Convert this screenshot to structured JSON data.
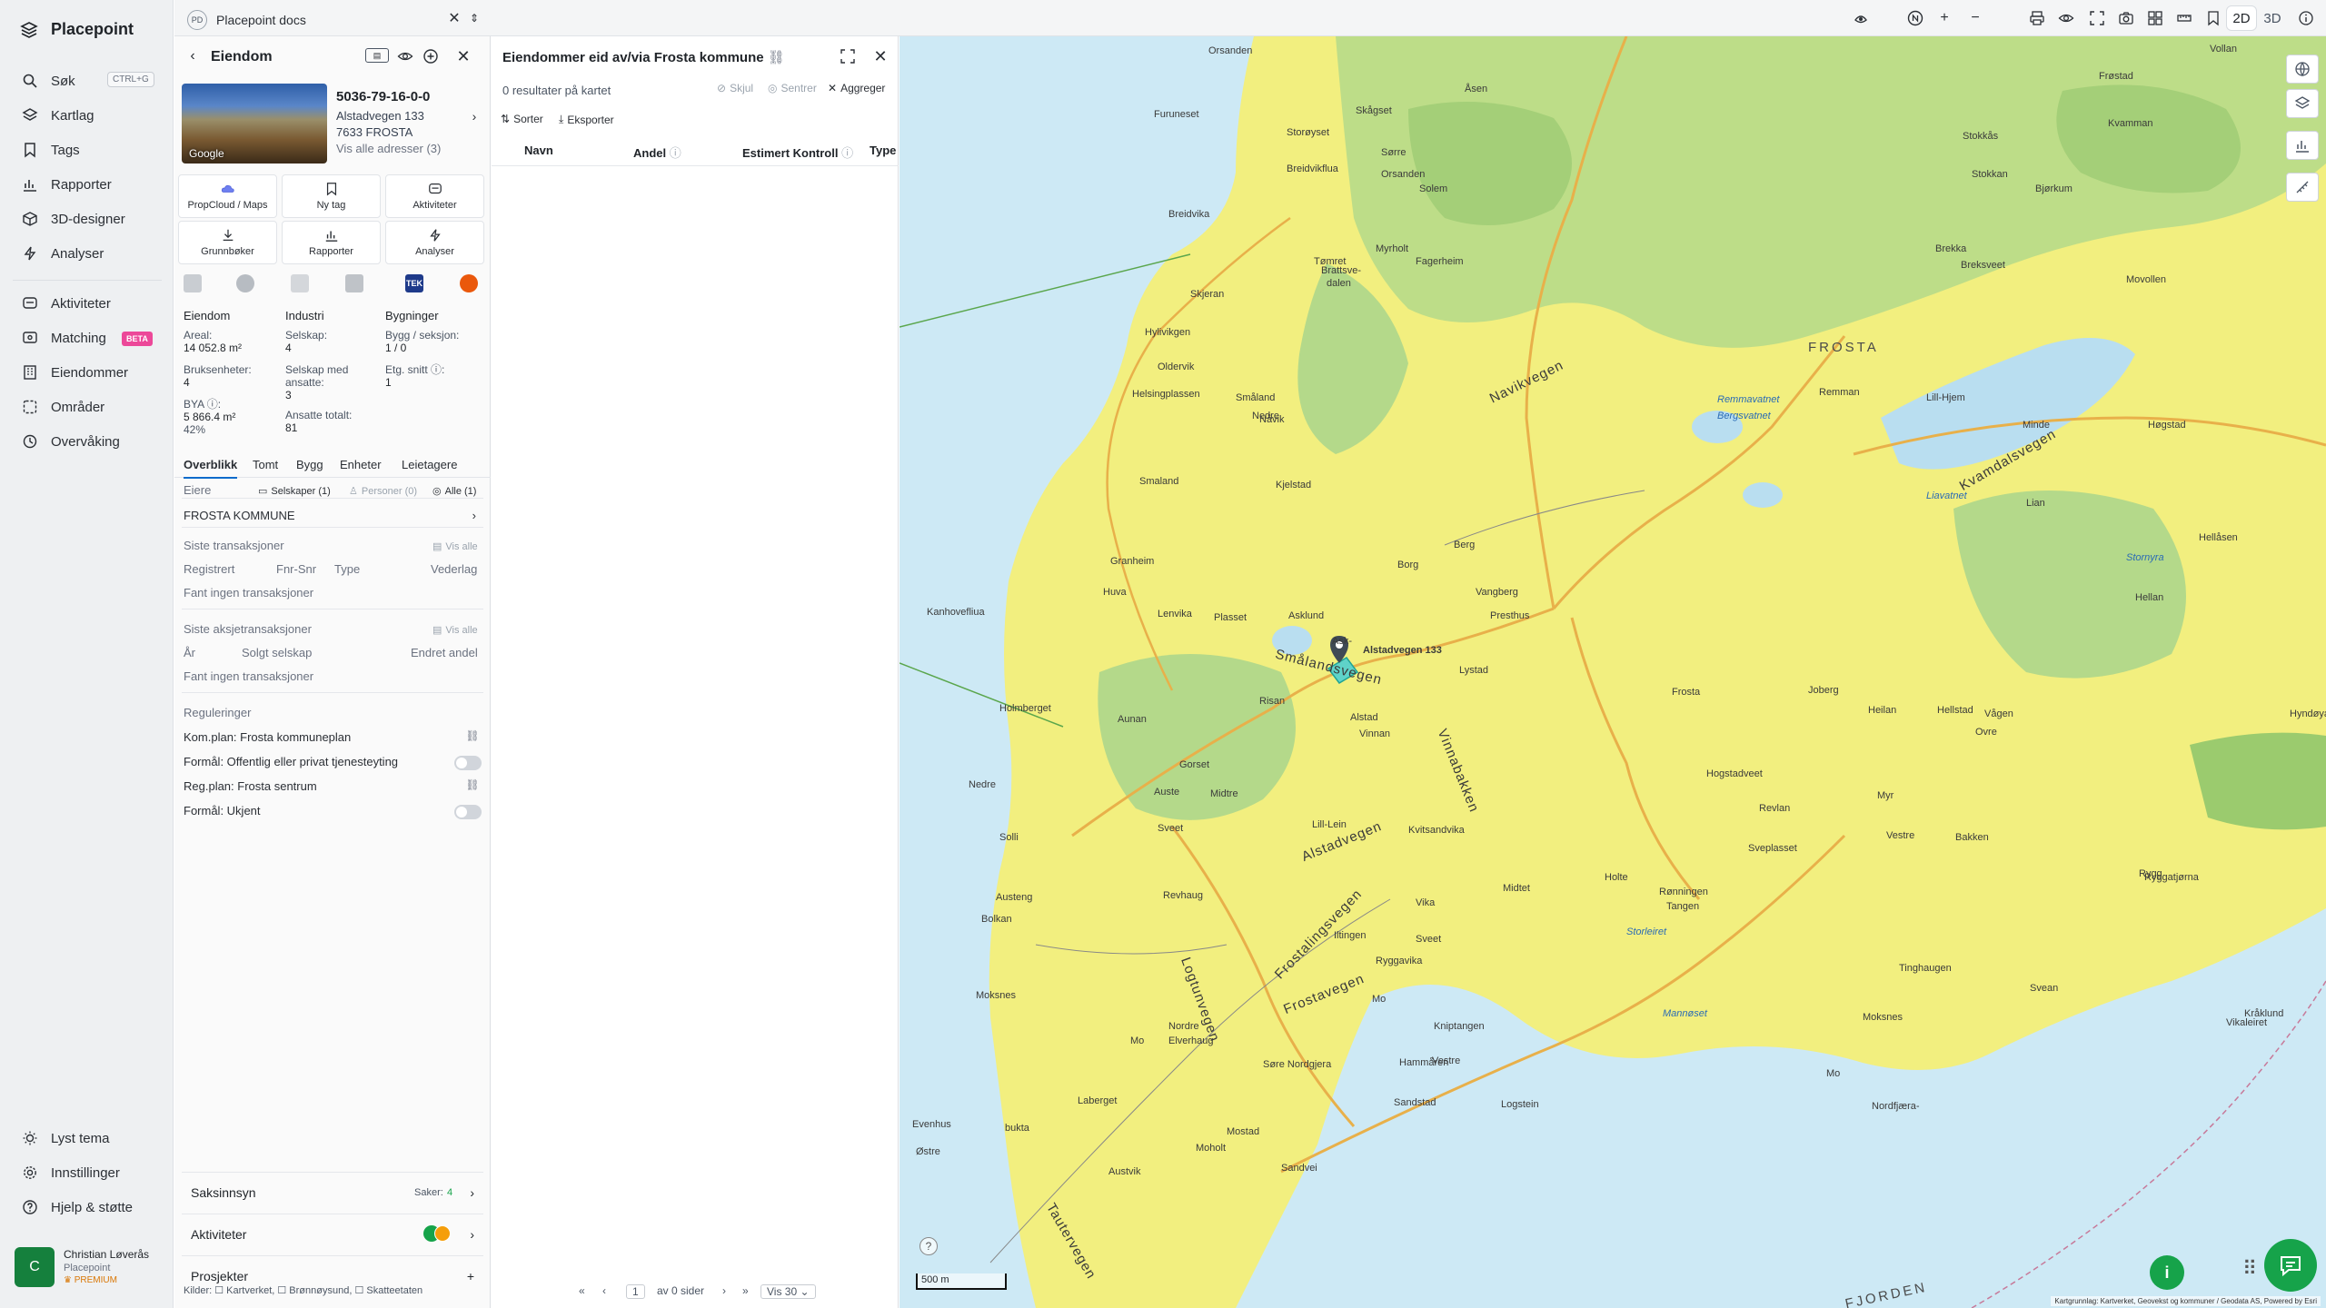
{
  "app": {
    "name": "Placepoint"
  },
  "sidebar": {
    "items": [
      {
        "label": "Søk",
        "shortcut": "CTRL+G",
        "icon": "search-icon"
      },
      {
        "label": "Kartlag",
        "icon": "layers-icon"
      },
      {
        "label": "Tags",
        "icon": "bookmark-icon"
      },
      {
        "label": "Rapporter",
        "icon": "chart-icon"
      },
      {
        "label": "3D-designer",
        "icon": "cube-icon"
      },
      {
        "label": "Analyser",
        "icon": "bolt-icon"
      },
      {
        "label": "Aktiviteter",
        "icon": "activity-icon"
      },
      {
        "label": "Matching",
        "badge": "BETA",
        "icon": "matching-icon"
      },
      {
        "label": "Eiendommer",
        "icon": "building-icon"
      },
      {
        "label": "Områder",
        "icon": "area-icon"
      },
      {
        "label": "Overvåking",
        "icon": "monitor-icon"
      }
    ],
    "bottom": [
      {
        "label": "Lyst tema",
        "icon": "sun-icon"
      },
      {
        "label": "Innstillinger",
        "icon": "gear-icon"
      },
      {
        "label": "Hjelp & støtte",
        "icon": "help-icon"
      }
    ],
    "user": {
      "initial": "C",
      "name": "Christian Løverås",
      "org": "Placepoint",
      "plan": "PREMIUM"
    }
  },
  "tabbar": {
    "badge": "PD",
    "doc_title": "Placepoint docs",
    "view_2d": "2D",
    "view_3d": "3D"
  },
  "property": {
    "header": "Eiendom",
    "photo_credit": "Google",
    "id": "5036-79-16-0-0",
    "address": "Alstadvegen 133",
    "postal": "7633 FROSTA",
    "all_addresses": "Vis alle adresser (3)",
    "actions": [
      "PropCloud / Maps",
      "Ny tag",
      "Aktiviteter",
      "Grunnbøker",
      "Rapporter",
      "Analyser"
    ],
    "tek_badge": "TEK",
    "stats": {
      "col1_header": "Eiendom",
      "col2_header": "Industri",
      "col3_header": "Bygninger",
      "areal_label": "Areal:",
      "areal_value": "14 052.8 m²",
      "bruks_label": "Bruksenheter:",
      "bruks_value": "4",
      "bya_label": "BYA ⓘ:",
      "bya_value": "5 866.4 m²",
      "bya_pct": "42%",
      "selskap_label": "Selskap:",
      "selskap_value": "4",
      "ansatte_label": "Selskap med ansatte:",
      "ansatte_value": "3",
      "ansatte_tot_label": "Ansatte totalt:",
      "ansatte_tot_value": "81",
      "bygg_label": "Bygg / seksjon:",
      "bygg_value": "1 / 0",
      "etg_label": "Etg. snitt ⓘ:",
      "etg_value": "1"
    },
    "tabs": [
      "Overblikk",
      "Tomt",
      "Bygg",
      "Enheter",
      "Leietagere"
    ],
    "owners": {
      "label": "Eiere",
      "filter_companies": "Selskaper (1)",
      "filter_persons": "Personer (0)",
      "filter_all": "Alle (1)",
      "owner": "FROSTA KOMMUNE"
    },
    "transactions": {
      "title": "Siste transaksjoner",
      "see_all": "Vis alle",
      "cols": [
        "Registrert",
        "Fnr-Snr",
        "Type",
        "Vederlag"
      ],
      "empty": "Fant ingen transaksjoner"
    },
    "share_tx": {
      "title": "Siste aksjetransaksjoner",
      "see_all": "Vis alle",
      "cols": [
        "År",
        "Solgt selskap",
        "Endret andel"
      ],
      "empty": "Fant ingen transaksjoner"
    },
    "regulations": {
      "title": "Reguleringer",
      "items": [
        "Kom.plan: Frosta kommuneplan",
        "Formål: Offentlig eller privat tjenesteyting",
        "Reg.plan: Frosta sentrum",
        "Formål: Ukjent"
      ]
    },
    "sections": {
      "saksinnsyn": "Saksinnsyn",
      "saker": "Saker:",
      "saker_count": "4",
      "aktiviteter": "Aktiviteter",
      "prosjekter": "Prosjekter"
    },
    "sources": "Kilder: ☐ Kartverket, ☐ Brønnøysund, ☐ Skatteetaten"
  },
  "results": {
    "title": "Eiendommer eid av/via Frosta kommune",
    "count": "0 resultater på kartet",
    "hide": "Skjul",
    "center": "Sentrer",
    "aggregate": "Aggreger",
    "sort": "Sorter",
    "export": "Eksporter",
    "columns": [
      "Navn",
      "Andel",
      "Estimert Kontroll",
      "Type"
    ],
    "pager": {
      "page": "1",
      "of_pages": "av 0 sider",
      "per_page": "Vis 30"
    }
  },
  "map": {
    "scale": "500 m",
    "attribution": "Kartgrunnlag: Kartverket, Geovekst og kommuner / Geodata AS, Powered by Esri",
    "pin_label": "Alstadvegen 133",
    "places": [
      "Orsanden",
      "Frøstad",
      "Furuneset",
      "Skågset",
      "Åsen",
      "Vollan",
      "Kvamman",
      "Storøyset",
      "Sørre",
      "Stokkås",
      "Breidvikflua",
      "Orsanden",
      "Solem",
      "Stokkan",
      "Bjørkum",
      "Breidvika",
      "Tømret",
      "Myrholt",
      "Brekka",
      "Breksveet",
      "Movollen",
      "Brattsve-",
      "dalen",
      "Fagerheim",
      "Skjeran",
      "Hylivikgen",
      "Oldervik",
      "Helsingplassen",
      "Småland",
      "Nedre",
      "Nåvik",
      "Remman",
      "Lill-Hjem",
      "Minde",
      "Høgstad",
      "Kjelstad",
      "Smaland",
      "Lian",
      "Hellåsen",
      "Granheim",
      "Borg",
      "Berg",
      "Vangberg",
      "Hellan",
      "Huva",
      "Lenvika",
      "Plasset",
      "Asklund",
      "Presthus",
      "Kanhovefliua",
      "Ask-",
      "Lystad",
      "Risan",
      "Frosta",
      "Holmberget",
      "Aunan",
      "Alstad",
      "Vinnan",
      "Joberg",
      "Heilan",
      "Hellstad",
      "Vågen",
      "Hyndøya",
      "Ovre",
      "Gorset",
      "Hogstadveet",
      "Nedre",
      "Midtre",
      "Auste",
      "Revlan",
      "Myr",
      "Bakken",
      "Vestre",
      "Solli",
      "Lill-Lein",
      "Sveet",
      "Kvitsandvika",
      "Sveplasset",
      "Rygg",
      "Ryggatjørna",
      "Revhaug",
      "Holte",
      "Midtet",
      "Vika",
      "Rønningen",
      "Tangen",
      "Austeng",
      "Bolkan",
      "Iltingen",
      "Sveet",
      "Moksnes",
      "Ryggavika",
      "Tinghaugen",
      "Svean",
      "Moksnes",
      "Nordre",
      "Mo",
      "Kråklund",
      "Elverhaug",
      "Kniptangen",
      "Mo",
      "Hammåren",
      "Vikaleiret",
      "Søre Nordgjera",
      "Vestre",
      "Logstein",
      "Laberget",
      "Sandstad",
      "Mo",
      "Mostad",
      "Nordfjæra-",
      "bukta",
      "Moholt",
      "Sandvei",
      "Evenhus",
      "Østre",
      "Austvik"
    ],
    "waters": [
      "Remmavatnet",
      "Bergsvatnet",
      "Liavatnet",
      "Stornyra",
      "Storleiret",
      "Mannøset"
    ],
    "roads": [
      "Navikvegen",
      "Smålandsvegen",
      "Vinnabakken",
      "Alstadvegen",
      "Frostalingsvegen",
      "Frostavegen",
      "Logtunvegen",
      "Kvamdalsvegen",
      "Tautervegen"
    ],
    "areas": [
      "FROSTA",
      "FJORDEN"
    ]
  }
}
